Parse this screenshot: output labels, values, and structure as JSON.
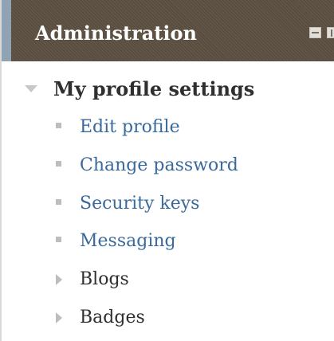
{
  "block": {
    "title": "Administration",
    "controls": [
      {
        "icon": "dock-icon"
      },
      {
        "icon": "move-icon"
      }
    ]
  },
  "tree": {
    "root": {
      "label": "My profile settings",
      "expanded": true
    },
    "items": [
      {
        "label": "Edit profile",
        "type": "link"
      },
      {
        "label": "Change password",
        "type": "link"
      },
      {
        "label": "Security keys",
        "type": "link"
      },
      {
        "label": "Messaging",
        "type": "link"
      },
      {
        "label": "Blogs",
        "type": "branch",
        "expanded": false
      },
      {
        "label": "Badges",
        "type": "branch",
        "expanded": false
      }
    ]
  },
  "colors": {
    "header_bg": "#5a4e40",
    "header_accent": "#8fa3b5",
    "link": "#3a6a9b",
    "text": "#2f2f2f",
    "icon_grey": "#bdbdbd"
  }
}
